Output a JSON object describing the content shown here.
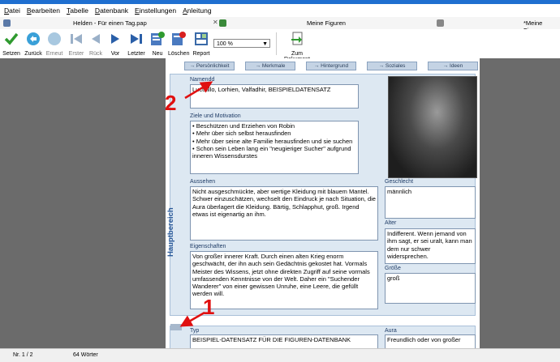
{
  "menu": [
    "Datei",
    "Bearbeiten",
    "Tabelle",
    "Datenbank",
    "Einstellungen",
    "Anleitung"
  ],
  "tabs": [
    {
      "title": "Helden - Für einen Tag.pap"
    },
    {
      "title": "Meine Figuren"
    },
    {
      "title": "*Meine Figuren"
    }
  ],
  "toolbar": {
    "setzen": "Setzen",
    "zurueck": "Zurück",
    "erneut": "Erneut",
    "erster": "Erster",
    "rueck": "Rück",
    "vor": "Vor",
    "letzter": "Letzter",
    "neu": "Neu",
    "loeschen": "Löschen",
    "report": "Report",
    "zoom": "100 %",
    "zum_dokument": "Zum Dokument"
  },
  "nav": [
    "→ Persönlichkeit",
    "→ Merkmale",
    "→ Hintergrund",
    "→ Soziales",
    "→ Ideen"
  ],
  "section_label": "Hauptbereich",
  "fields": {
    "name_label": "Namendd",
    "name_value": "Lucutillo, Lorhien, Valfadhir, BEISPIELDATENSATZ",
    "ziele_label": "Ziele und Motivation",
    "ziele_lines": [
      "• Beschützen und Erziehen von Robin",
      "• Mehr über sich selbst herausfinden",
      "• Mehr über seine alte Familie herausfinden und sie suchen",
      "• Schon sein Leben lang ein \"neugieriger Sucher\" aufgrund inneren Wissensdurstes"
    ],
    "aussehen_label": "Aussehen",
    "aussehen_value": "Nicht ausgeschmückte, aber wertige Kleidung mit blauem Mantel. Schwer einzuschätzen, wechselt den Eindruck je nach Situation, die Aura überlagert die Kleidung. Bärtig, Schlapphut, groß. Irgend etwas ist eigenartig an ihm.",
    "geschlecht_label": "Geschlecht",
    "geschlecht_value": "männlich",
    "alter_label": "Alter",
    "alter_value": "Indifferent. Wenn jemand von ihm sagt, er sei uralt, kann man dem nur schwer widersprechen.",
    "eigenschaften_label": "Eigenschaften",
    "eigenschaften_value": "Von großer innerer Kraft. Durch einen alten Krieg enorm geschwächt, der ihn auch sein Gedächtnis gekostet hat. Vormals Meister des Wissens, jetzt ohne direkten Zugriff auf seine vormals umfassenden Kenntnisse von der Welt. Daher ein \"Suchender Wanderer\" von einer gewissen Unruhe, eine Leere, die gefüllt werden will.",
    "groesse_label": "Größe",
    "groesse_value": "groß",
    "typ_label": "Typ",
    "typ_value": "BEISPIEL-DATENSATZ FÜR DIE FIGUREN-DATENBANK",
    "aura_label": "Aura",
    "aura_value": "Freundlich oder von großer"
  },
  "status": {
    "record": "Nr. 1 / 2",
    "words": "64 Wörter"
  },
  "annotations": [
    "1",
    "2"
  ],
  "colors": {
    "accent": "#1f6fd0",
    "section_bg": "#dde8f2",
    "annotation": "#e01010"
  }
}
